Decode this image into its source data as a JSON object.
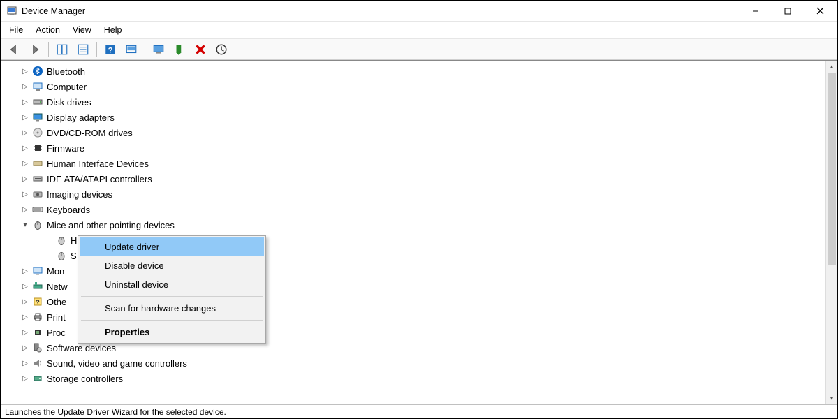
{
  "window": {
    "title": "Device Manager"
  },
  "menu": {
    "file": "File",
    "action": "Action",
    "view": "View",
    "help": "Help"
  },
  "tree": {
    "bluetooth": "Bluetooth",
    "computer": "Computer",
    "disk": "Disk drives",
    "display": "Display adapters",
    "dvd": "DVD/CD-ROM drives",
    "firmware": "Firmware",
    "hid": "Human Interface Devices",
    "ide": "IDE ATA/ATAPI controllers",
    "imaging": "Imaging devices",
    "keyboards": "Keyboards",
    "mice": "Mice and other pointing devices",
    "mouse_hid": "HID-compliant mouse",
    "mouse_syn": "S",
    "monitors": "Mon",
    "network": "Netw",
    "other": "Othe",
    "print": "Print",
    "processors": "Proc",
    "software": "Software devices",
    "sound": "Sound, video and game controllers",
    "storage": "Storage controllers"
  },
  "context_menu": {
    "update": "Update driver",
    "disable": "Disable device",
    "uninstall": "Uninstall device",
    "scan": "Scan for hardware changes",
    "properties": "Properties"
  },
  "statusbar": {
    "text": "Launches the Update Driver Wizard for the selected device."
  }
}
